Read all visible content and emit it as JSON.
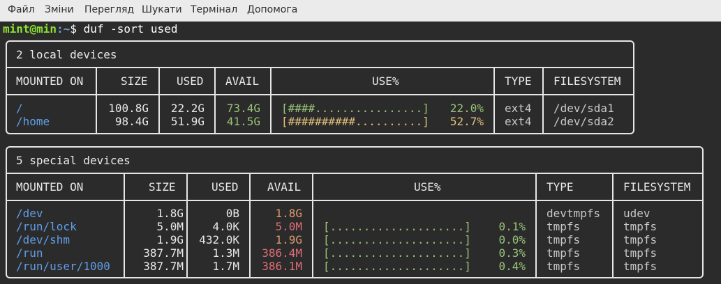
{
  "menu": [
    "Файл",
    "Зміни",
    "Перегляд",
    "Шукати",
    "Термінал",
    "Допомога"
  ],
  "prompt": {
    "user_host": "mint@min",
    "path": ":~",
    "symbol": "$ ",
    "command": "duf -sort used"
  },
  "local": {
    "title": "2 local devices",
    "headers": [
      "MOUNTED ON",
      "SIZE",
      "USED",
      "AVAIL",
      "USE%",
      "TYPE",
      "FILESYSTEM"
    ],
    "rows": [
      {
        "mount": "/",
        "size": "100.8G",
        "used": "22.2G",
        "avail": "73.4G",
        "bar": "[####................]",
        "pct": "22.0%",
        "type": "ext4",
        "fs": "/dev/sda1"
      },
      {
        "mount": "/home",
        "size": "98.4G",
        "used": "51.9G",
        "avail": "41.5G",
        "bar": "[##########..........]",
        "pct": "52.7%",
        "type": "ext4",
        "fs": "/dev/sda2"
      }
    ]
  },
  "special": {
    "title": "5 special devices",
    "headers": [
      "MOUNTED ON",
      "SIZE",
      "USED",
      "AVAIL",
      "USE%",
      "TYPE",
      "FILESYSTEM"
    ],
    "rows": [
      {
        "mount": "/dev",
        "size": "1.8G",
        "used": "0B",
        "avail": "1.8G",
        "bar": "",
        "pct": "",
        "type": "devtmpfs",
        "fs": "udev"
      },
      {
        "mount": "/run/lock",
        "size": "5.0M",
        "used": "4.0K",
        "avail": "5.0M",
        "bar": "[....................]",
        "pct": "0.1%",
        "type": "tmpfs",
        "fs": "tmpfs"
      },
      {
        "mount": "/dev/shm",
        "size": "1.9G",
        "used": "432.0K",
        "avail": "1.9G",
        "bar": "[....................]",
        "pct": "0.0%",
        "type": "tmpfs",
        "fs": "tmpfs"
      },
      {
        "mount": "/run",
        "size": "387.7M",
        "used": "1.3M",
        "avail": "386.4M",
        "bar": "[....................]",
        "pct": "0.3%",
        "type": "tmpfs",
        "fs": "tmpfs"
      },
      {
        "mount": "/run/user/1000",
        "size": "387.7M",
        "used": "1.7M",
        "avail": "386.1M",
        "bar": "[....................]",
        "pct": "0.4%",
        "type": "tmpfs",
        "fs": "tmpfs"
      }
    ]
  }
}
